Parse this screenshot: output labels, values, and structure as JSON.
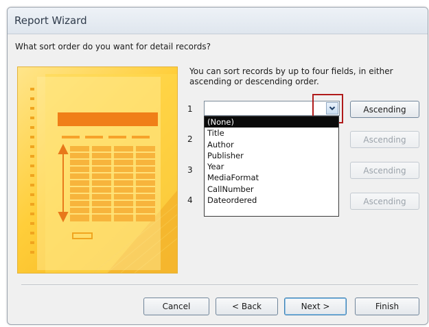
{
  "window": {
    "title": "Report Wizard"
  },
  "question": "What sort order do you want for detail records?",
  "instructions": "You can sort records by up to four fields, in either ascending or descending order.",
  "sort_rows": [
    {
      "number": "1",
      "value": "",
      "order": "Ascending",
      "enabled": true
    },
    {
      "number": "2",
      "value": "",
      "order": "Ascending",
      "enabled": false
    },
    {
      "number": "3",
      "value": "",
      "order": "Ascending",
      "enabled": false
    },
    {
      "number": "4",
      "value": "",
      "order": "Ascending",
      "enabled": false
    }
  ],
  "dropdown_options": [
    "(None)",
    "Title",
    "Author",
    "Publisher",
    "Year",
    "MediaFormat",
    "CallNumber",
    "Dateordered"
  ],
  "dropdown_selected_index": 0,
  "buttons": {
    "cancel": "Cancel",
    "back": "< Back",
    "next": "Next >",
    "finish": "Finish"
  },
  "colors": {
    "highlight_box": "#b01a1a",
    "art_yellow": "#ffce3a",
    "art_orange": "#f0a824",
    "selected_option_bg": "#0a0a0a"
  },
  "icons": {
    "combo_arrow": "chevron-down-icon"
  }
}
